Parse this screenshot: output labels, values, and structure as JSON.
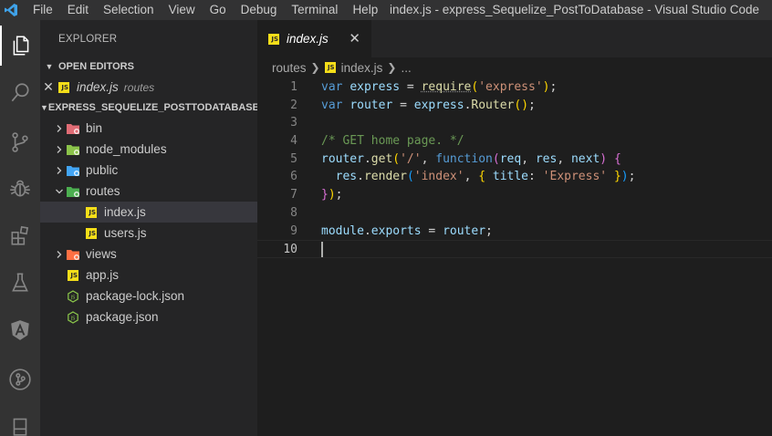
{
  "window_title": "index.js - express_Sequelize_PostToDatabase - Visual Studio Code",
  "menu": [
    "File",
    "Edit",
    "Selection",
    "View",
    "Go",
    "Debug",
    "Terminal",
    "Help"
  ],
  "activity_bar": [
    "explorer-icon",
    "search-icon",
    "source-control-icon",
    "debug-icon",
    "extensions-icon",
    "test-flask-icon",
    "angular-icon",
    "git-graph-icon",
    "panel-icon"
  ],
  "sidebar": {
    "title": "EXPLORER",
    "open_editors": {
      "header": "OPEN EDITORS",
      "items": [
        {
          "name": "index.js",
          "description": "routes",
          "icon": "js-file-icon"
        }
      ]
    },
    "project": {
      "header": "EXPRESS_SEQUELIZE_POSTTODATABASE",
      "tree": [
        {
          "name": "bin",
          "type": "folder",
          "expanded": false,
          "depth": 0,
          "icon": "folder-bin-icon",
          "color": "#e06c75"
        },
        {
          "name": "node_modules",
          "type": "folder",
          "expanded": false,
          "depth": 0,
          "icon": "folder-node-icon",
          "color": "#8bc34a"
        },
        {
          "name": "public",
          "type": "folder",
          "expanded": false,
          "depth": 0,
          "icon": "folder-public-icon",
          "color": "#42a5f5"
        },
        {
          "name": "routes",
          "type": "folder",
          "expanded": true,
          "depth": 0,
          "icon": "folder-routes-icon",
          "color": "#4caf50"
        },
        {
          "name": "index.js",
          "type": "file",
          "depth": 1,
          "icon": "js-file-icon",
          "selected": true
        },
        {
          "name": "users.js",
          "type": "file",
          "depth": 1,
          "icon": "js-file-icon"
        },
        {
          "name": "views",
          "type": "folder",
          "expanded": false,
          "depth": 0,
          "icon": "folder-views-icon",
          "color": "#ff7043"
        },
        {
          "name": "app.js",
          "type": "file",
          "depth": 0,
          "icon": "js-file-icon"
        },
        {
          "name": "package-lock.json",
          "type": "file",
          "depth": 0,
          "icon": "nodejs-icon"
        },
        {
          "name": "package.json",
          "type": "file",
          "depth": 0,
          "icon": "nodejs-icon"
        }
      ]
    }
  },
  "editor": {
    "tab": {
      "name": "index.js",
      "close": "✕"
    },
    "breadcrumb": {
      "folder": "routes",
      "file": "index.js",
      "more": "..."
    },
    "lines": [
      [
        [
          "kw",
          "var"
        ],
        [
          "pun",
          " "
        ],
        [
          "var",
          "express"
        ],
        [
          "op",
          " = "
        ],
        [
          "fn squig",
          "require"
        ],
        [
          "br1",
          "("
        ],
        [
          "str",
          "'express'"
        ],
        [
          "br1",
          ")"
        ],
        [
          "pun",
          ";"
        ]
      ],
      [
        [
          "kw",
          "var"
        ],
        [
          "pun",
          " "
        ],
        [
          "var",
          "router"
        ],
        [
          "op",
          " = "
        ],
        [
          "var",
          "express"
        ],
        [
          "pun",
          "."
        ],
        [
          "fn",
          "Router"
        ],
        [
          "br1",
          "("
        ],
        [
          "br1",
          ")"
        ],
        [
          "pun",
          ";"
        ]
      ],
      [],
      [
        [
          "cm",
          "/* GET home page. */"
        ]
      ],
      [
        [
          "var",
          "router"
        ],
        [
          "pun",
          "."
        ],
        [
          "fn",
          "get"
        ],
        [
          "br1",
          "("
        ],
        [
          "str",
          "'/'"
        ],
        [
          "pun",
          ", "
        ],
        [
          "fnkw",
          "function"
        ],
        [
          "br2",
          "("
        ],
        [
          "var",
          "req"
        ],
        [
          "pun",
          ", "
        ],
        [
          "var",
          "res"
        ],
        [
          "pun",
          ", "
        ],
        [
          "var",
          "next"
        ],
        [
          "br2",
          ")"
        ],
        [
          "pun",
          " "
        ],
        [
          "br2",
          "{"
        ]
      ],
      [
        [
          "pun",
          "  "
        ],
        [
          "var",
          "res"
        ],
        [
          "pun",
          "."
        ],
        [
          "fn",
          "render"
        ],
        [
          "br3",
          "("
        ],
        [
          "str",
          "'index'"
        ],
        [
          "pun",
          ", "
        ],
        [
          "br1",
          "{"
        ],
        [
          "pun",
          " "
        ],
        [
          "var",
          "title"
        ],
        [
          "pun",
          ": "
        ],
        [
          "str",
          "'Express'"
        ],
        [
          "pun",
          " "
        ],
        [
          "br1",
          "}"
        ],
        [
          "br3",
          ")"
        ],
        [
          "pun",
          ";"
        ]
      ],
      [
        [
          "br2",
          "}"
        ],
        [
          "br1",
          ")"
        ],
        [
          "pun",
          ";"
        ]
      ],
      [],
      [
        [
          "var",
          "module"
        ],
        [
          "pun",
          "."
        ],
        [
          "var",
          "exports"
        ],
        [
          "op",
          " = "
        ],
        [
          "var",
          "router"
        ],
        [
          "pun",
          ";"
        ]
      ],
      []
    ],
    "line_numbers": [
      "1",
      "2",
      "3",
      "4",
      "5",
      "6",
      "7",
      "8",
      "9",
      "10"
    ],
    "current_line": 10
  }
}
